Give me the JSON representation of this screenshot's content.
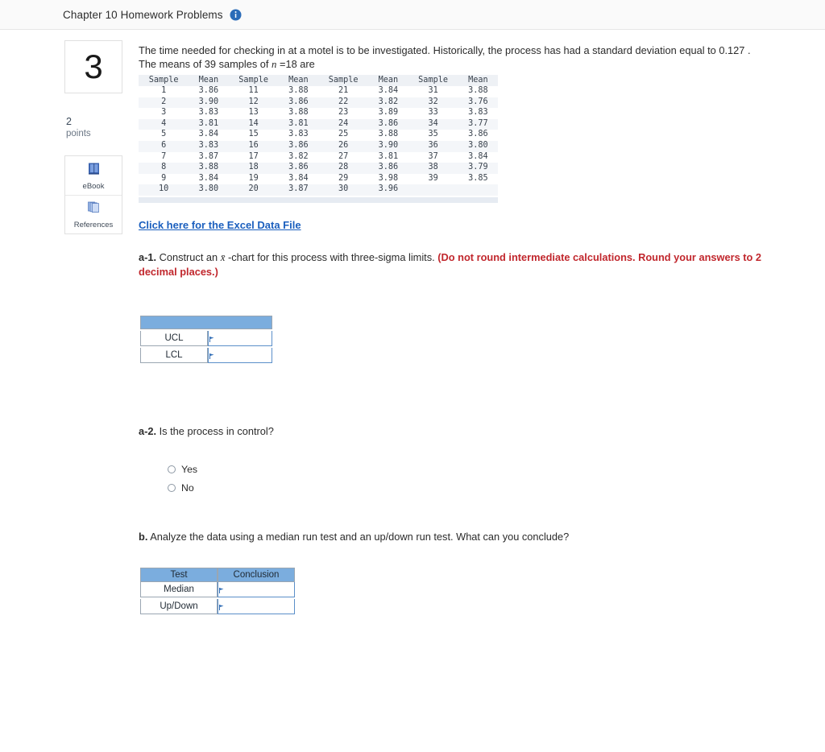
{
  "header": {
    "title": "Chapter 10 Homework Problems",
    "info_icon": "info-circle-icon"
  },
  "rail": {
    "question_number": "3",
    "points_value": "2",
    "points_label": "points",
    "tools": [
      {
        "icon": "ebook-icon",
        "label": "eBook"
      },
      {
        "icon": "references-icon",
        "label": "References"
      }
    ]
  },
  "question": {
    "text_part1": "The time needed for checking in at a motel is to be investigated. Historically, the process has had a standard deviation equal to ",
    "std_dev": "0.127",
    "text_part2": " .",
    "text_line2_pre": "The means of 39 samples of ",
    "n_symbol": "n",
    "text_line2_post": " =18 are"
  },
  "data_table": {
    "headers": [
      "Sample",
      "Mean",
      "Sample",
      "Mean",
      "Sample",
      "Mean",
      "Sample",
      "Mean"
    ],
    "rows": [
      [
        "1",
        "3.86",
        "11",
        "3.88",
        "21",
        "3.84",
        "31",
        "3.88"
      ],
      [
        "2",
        "3.90",
        "12",
        "3.86",
        "22",
        "3.82",
        "32",
        "3.76"
      ],
      [
        "3",
        "3.83",
        "13",
        "3.88",
        "23",
        "3.89",
        "33",
        "3.83"
      ],
      [
        "4",
        "3.81",
        "14",
        "3.81",
        "24",
        "3.86",
        "34",
        "3.77"
      ],
      [
        "5",
        "3.84",
        "15",
        "3.83",
        "25",
        "3.88",
        "35",
        "3.86"
      ],
      [
        "6",
        "3.83",
        "16",
        "3.86",
        "26",
        "3.90",
        "36",
        "3.80"
      ],
      [
        "7",
        "3.87",
        "17",
        "3.82",
        "27",
        "3.81",
        "37",
        "3.84"
      ],
      [
        "8",
        "3.88",
        "18",
        "3.86",
        "28",
        "3.86",
        "38",
        "3.79"
      ],
      [
        "9",
        "3.84",
        "19",
        "3.84",
        "29",
        "3.98",
        "39",
        "3.85"
      ],
      [
        "10",
        "3.80",
        "20",
        "3.87",
        "30",
        "3.96",
        "",
        ""
      ]
    ]
  },
  "excel_link": {
    "label": "Click here for the Excel Data File"
  },
  "part_a1": {
    "prefix": "a-1.",
    "text_before": " Construct an ",
    "symbol": "x̄",
    "text_after": " -chart for this process with three-sigma limits. ",
    "instruction": "(Do not round intermediate calculations. Round your answers to 2 decimal places.)"
  },
  "limits_table": {
    "header_blank": "",
    "rows": [
      {
        "label": "UCL",
        "value": ""
      },
      {
        "label": "LCL",
        "value": ""
      }
    ]
  },
  "part_a2": {
    "prefix": "a-2.",
    "text": " Is the process in control?",
    "options": [
      {
        "label": "Yes",
        "selected": false
      },
      {
        "label": "No",
        "selected": false
      }
    ]
  },
  "part_b": {
    "prefix": "b.",
    "text": " Analyze the data using a median run test and an up/down run test. What can you conclude?"
  },
  "conclusion_table": {
    "headers": [
      "Test",
      "Conclusion"
    ],
    "rows": [
      {
        "label": "Median",
        "value": ""
      },
      {
        "label": "Up/Down",
        "value": ""
      }
    ]
  },
  "colors": {
    "accent_blue": "#7badde",
    "link_blue": "#1b5fbe",
    "red_instruction": "#c1272d",
    "header_bg": "#fafafa"
  }
}
